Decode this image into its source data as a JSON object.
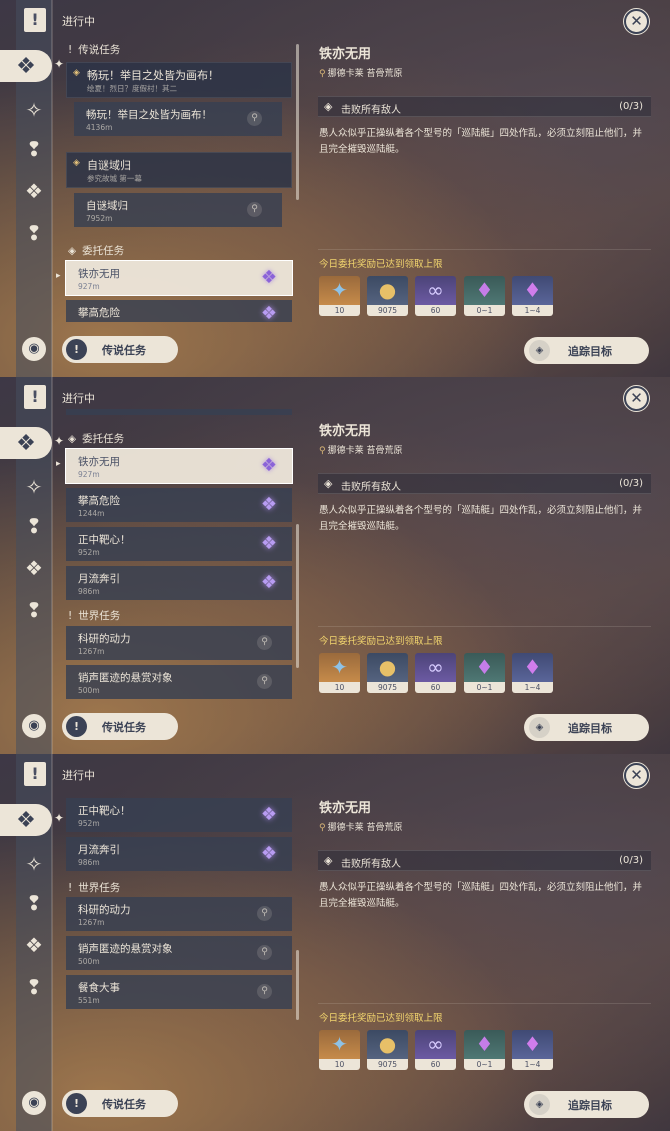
{
  "status": "进行中",
  "groups": {
    "legend": "传说任务",
    "commission": "委托任务",
    "world": "世界任务"
  },
  "legend_quests": [
    {
      "title": "畅玩！举目之处皆为画布！",
      "sub": "绘夏！烈日？度假村！其二",
      "step": "畅玩！举目之处皆为画布！",
      "dist": "4136m"
    },
    {
      "title": "自谜域归",
      "sub": "参究故城 第一幕",
      "step": "自谜域归",
      "dist": "7952m"
    }
  ],
  "commissions": [
    {
      "title": "铁亦无用",
      "dist": "927m"
    },
    {
      "title": "攀高危险",
      "dist": "1244m"
    },
    {
      "title": "正中靶心！",
      "dist": "952m"
    },
    {
      "title": "月流奔引",
      "dist": "986m"
    }
  ],
  "world_quests": [
    {
      "title": "科研的动力",
      "dist": "1267m"
    },
    {
      "title": "销声匿迹的悬赏对象",
      "dist": "500m"
    },
    {
      "title": "餐食大事",
      "dist": "551m"
    }
  ],
  "detail": {
    "title": "铁亦无用",
    "location": "挪德卡莱 苔骨荒原",
    "objective": "击败所有敌人",
    "objective_count": "(0/3)",
    "description": "愚人众似乎正操纵着各个型号的「巡陆艇」四处作乱，必须立刻阻止他们，并且完全摧毁巡陆艇。",
    "reward_notice": "今日委托奖励已达到领取上限",
    "rewards": [
      {
        "icon": "starglitter-icon",
        "qty": "10"
      },
      {
        "icon": "mora-icon",
        "qty": "9075"
      },
      {
        "icon": "companionship-exp-icon",
        "qty": "60"
      },
      {
        "icon": "crystal-green-icon",
        "qty": "0~1"
      },
      {
        "icon": "crystal-blue-icon",
        "qty": "1~4"
      }
    ]
  },
  "buttons": {
    "legend": "传说任务",
    "track": "追踪目标"
  },
  "icons": {
    "close": "close-icon",
    "quest_book": "quest-book-icon",
    "pin": "location-pin-icon",
    "gem": "commission-gem-icon"
  }
}
